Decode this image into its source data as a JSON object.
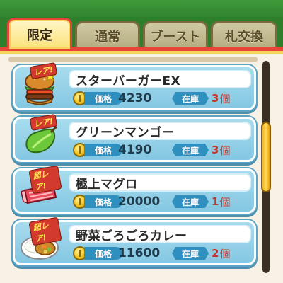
{
  "tabs": [
    {
      "label": "限定",
      "active": true
    },
    {
      "label": "通常",
      "active": false
    },
    {
      "label": "ブースト",
      "active": false
    },
    {
      "label": "札交換",
      "active": false
    }
  ],
  "labels": {
    "price": "価格",
    "stock": "在庫",
    "stock_unit": "個"
  },
  "items": [
    {
      "name": "スターバーガーEX",
      "rarity": "レア!",
      "icon": "burger-icon",
      "price": "4230",
      "stock": "3"
    },
    {
      "name": "グリーンマンゴー",
      "rarity": "レア!",
      "icon": "mango-icon",
      "price": "4190",
      "stock": "3"
    },
    {
      "name": "極上マグロ",
      "rarity": "超レア!",
      "icon": "tuna-icon",
      "price": "20000",
      "stock": "1"
    },
    {
      "name": "野菜ごろごろカレー",
      "rarity": "超レア!",
      "icon": "curry-icon",
      "price": "11600",
      "stock": "2"
    }
  ],
  "colors": {
    "active_tab": "#fbe27a",
    "tab_bar": "#2f7e2c",
    "card": "#a8dcee",
    "stock_value": "#c0392b"
  }
}
